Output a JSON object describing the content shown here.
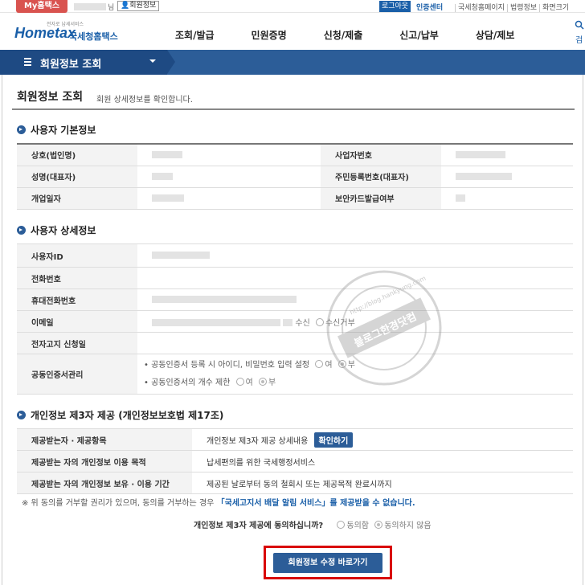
{
  "topbar": {
    "my_hometax": "My홈택스",
    "user_suffix": "님",
    "member_info": "회원정보",
    "logout": "로그아웃",
    "cert_center": "인증센터",
    "links": [
      "국세청홈페이지",
      "법령정보",
      "화면크기"
    ]
  },
  "header": {
    "logo_tagline": "전자로 납세서비스",
    "logo_main": "Hometax",
    "logo_kr": "국세청홈택스",
    "menu": [
      "조회/발급",
      "민원증명",
      "신청/제출",
      "신고/납부",
      "상담/제보"
    ],
    "search_label": "검"
  },
  "titlebar": {
    "title": "회원정보 조회"
  },
  "page": {
    "title": "회원정보 조회",
    "description": "회원 상세정보를 확인합니다."
  },
  "basic": {
    "heading": "사용자 기본정보",
    "rows": [
      {
        "left_label": "상호(법인명)",
        "right_label": "사업자번호"
      },
      {
        "left_label": "성명(대표자)",
        "right_label": "주민등록번호(대표자)"
      },
      {
        "left_label": "개업일자",
        "right_label": "보안카드발급여부"
      }
    ]
  },
  "detail": {
    "heading": "사용자 상세정보",
    "user_id": "사용자ID",
    "phone": "전화번호",
    "mobile": "휴대전화번호",
    "email": "이메일",
    "email_receive": "수신",
    "email_reject": "수신거부",
    "notice_date": "전자고지 신청일",
    "cert_mgmt": "공동인증서관리",
    "cert_line1": "공동인증서 등록 시 아이디, 비밀번호 입력 설정",
    "cert_line2": "공동인증서의 개수 제한",
    "yes": "여",
    "no": "부"
  },
  "third": {
    "heading": "개인정보 제3자 제공 (개인정보보호법 제17조)",
    "rows": [
      {
        "label": "제공받는자 · 제공항목",
        "value": "개인정보 제3자 제공 상세내용",
        "button": "확인하기"
      },
      {
        "label": "제공받는 자의 개인정보 이용 목적",
        "value": "납세편의를 위한 국세행정서비스"
      },
      {
        "label": "제공받는 자의 개인정보 보유 · 이용 기간",
        "value": "제공된 날로부터 동의 철회시 또는 제공목적 완료시까지"
      }
    ]
  },
  "notice": {
    "text": "※ 위 동의를 거부할 권리가 있으며, 동의를 거부하는 경우",
    "highlight": "「국세고지서 배달 알림 서비스」를 제공받을 수 없습니다."
  },
  "agree": {
    "question": "개인정보 제3자 제공에 동의하십니까?",
    "agree": "동의함",
    "disagree": "동의하지 않음"
  },
  "edit_button": "회원정보 수정 바로가기",
  "watermark": {
    "text1": "블로그한경닷컴",
    "url": "http://blog.hankyung.com"
  }
}
